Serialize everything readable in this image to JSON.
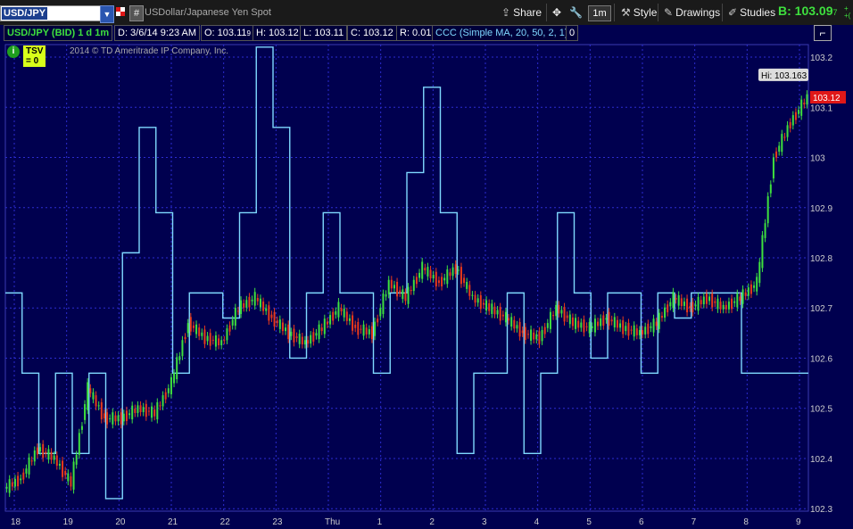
{
  "toolbar": {
    "symbol": "USD/JPY",
    "description": "USDollar/Japanese Yen Spot",
    "share_label": "Share",
    "timeframe": "1m",
    "style_label": "Style",
    "drawings_label": "Drawings",
    "studies_label": "Studies",
    "bid_label": "B: 103.09",
    "bid_tick": "7",
    "hash_label": "#"
  },
  "infobar": {
    "title": "USD/JPY (BID) 1 d 1m",
    "date": "D: 3/6/14 9:23 AM",
    "open": "O: 103.11",
    "open_tick": "9",
    "high": "H: 103.12",
    "low": "L: 103.11",
    "close": "C: 103.12",
    "range": "R: 0.01",
    "study": "CCC (Simple MA, 20, 50, 2, 1)",
    "study_value": "0"
  },
  "tsv": {
    "label": "TSV",
    "value": "= 0",
    "copyright": "2014 © TD Ameritrade IP Company, Inc.",
    "info_icon": "i"
  },
  "chart_data": {
    "type": "line",
    "price_axis": [
      "103.2",
      "103.1",
      "103",
      "102.9",
      "102.8",
      "102.7",
      "102.6",
      "102.5",
      "102.4",
      "102.3"
    ],
    "ylim": [
      102.295,
      103.225
    ],
    "x_labels": [
      "18",
      "19",
      "20",
      "21",
      "22",
      "23",
      "Thu",
      "1",
      "2",
      "3",
      "4",
      "5",
      "6",
      "7",
      "8",
      "9"
    ],
    "hi_label": "Hi: 103.163",
    "last_price": "103.12",
    "price_series": {
      "name": "USD/JPY",
      "points": [
        [
          0,
          102.34
        ],
        [
          1,
          102.36
        ],
        [
          2,
          102.42
        ],
        [
          3,
          102.4
        ],
        [
          4,
          102.35
        ],
        [
          5,
          102.54
        ],
        [
          6,
          102.48
        ],
        [
          7,
          102.48
        ],
        [
          8,
          102.5
        ],
        [
          9,
          102.49
        ],
        [
          10,
          102.55
        ],
        [
          11,
          102.67
        ],
        [
          12,
          102.64
        ],
        [
          13,
          102.63
        ],
        [
          14,
          102.7
        ],
        [
          15,
          102.72
        ],
        [
          16,
          102.68
        ],
        [
          17,
          102.65
        ],
        [
          18,
          102.63
        ],
        [
          19,
          102.66
        ],
        [
          20,
          102.7
        ],
        [
          21,
          102.66
        ],
        [
          22,
          102.65
        ],
        [
          23,
          102.75
        ],
        [
          24,
          102.72
        ],
        [
          25,
          102.78
        ],
        [
          26,
          102.75
        ],
        [
          27,
          102.78
        ],
        [
          28,
          102.72
        ],
        [
          29,
          102.7
        ],
        [
          30,
          102.68
        ],
        [
          31,
          102.65
        ],
        [
          32,
          102.64
        ],
        [
          33,
          102.7
        ],
        [
          34,
          102.67
        ],
        [
          35,
          102.66
        ],
        [
          36,
          102.68
        ],
        [
          37,
          102.66
        ],
        [
          38,
          102.65
        ],
        [
          39,
          102.67
        ],
        [
          40,
          102.72
        ],
        [
          41,
          102.7
        ],
        [
          42,
          102.72
        ],
        [
          43,
          102.7
        ],
        [
          44,
          102.72
        ],
        [
          45,
          102.75
        ],
        [
          46,
          103.0
        ],
        [
          47,
          103.07
        ],
        [
          48,
          103.12
        ]
      ]
    },
    "indicator_series": {
      "name": "TSV",
      "points": [
        [
          0,
          102.73
        ],
        [
          1,
          102.57
        ],
        [
          2,
          102.41
        ],
        [
          3,
          102.57
        ],
        [
          4,
          102.41
        ],
        [
          5,
          102.57
        ],
        [
          6,
          102.32
        ],
        [
          7,
          102.81
        ],
        [
          8,
          103.06
        ],
        [
          9,
          102.89
        ],
        [
          10,
          102.57
        ],
        [
          11,
          102.73
        ],
        [
          12,
          102.73
        ],
        [
          13,
          102.68
        ],
        [
          14,
          102.89
        ],
        [
          15,
          103.22
        ],
        [
          16,
          103.06
        ],
        [
          17,
          102.6
        ],
        [
          18,
          102.73
        ],
        [
          19,
          102.89
        ],
        [
          20,
          102.73
        ],
        [
          21,
          102.73
        ],
        [
          22,
          102.57
        ],
        [
          23,
          102.73
        ],
        [
          24,
          102.97
        ],
        [
          25,
          103.14
        ],
        [
          26,
          102.89
        ],
        [
          27,
          102.41
        ],
        [
          28,
          102.57
        ],
        [
          29,
          102.57
        ],
        [
          30,
          102.73
        ],
        [
          31,
          102.41
        ],
        [
          32,
          102.57
        ],
        [
          33,
          102.89
        ],
        [
          34,
          102.73
        ],
        [
          35,
          102.6
        ],
        [
          36,
          102.73
        ],
        [
          37,
          102.73
        ],
        [
          38,
          102.57
        ],
        [
          39,
          102.73
        ],
        [
          40,
          102.68
        ],
        [
          41,
          102.73
        ],
        [
          42,
          102.73
        ],
        [
          43,
          102.73
        ],
        [
          44,
          102.57
        ],
        [
          45,
          102.57
        ],
        [
          46,
          102.57
        ],
        [
          47,
          102.57
        ],
        [
          48,
          102.57
        ]
      ]
    },
    "colors": {
      "background": "#00004f",
      "grid": "#2c2cd0",
      "indicator": "#7fd9ff",
      "up": "#3ee03e",
      "down": "#e83a1a",
      "price_tag": "#e01818"
    }
  }
}
